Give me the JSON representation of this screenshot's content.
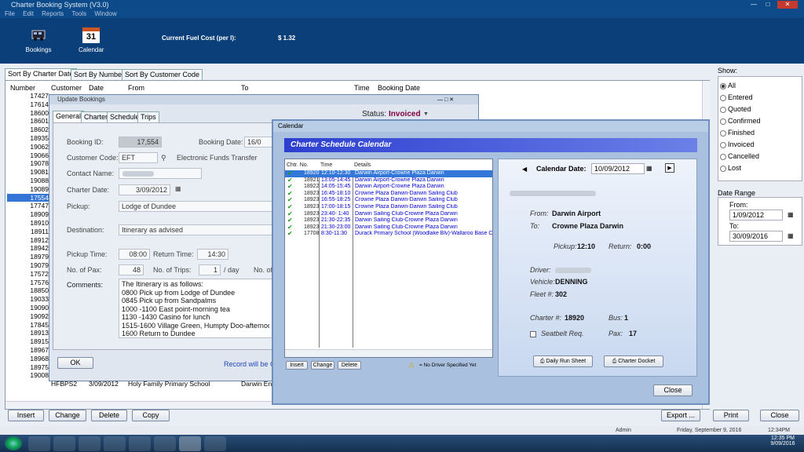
{
  "app": {
    "title": "Charter Booking System (V3.0)"
  },
  "menu": [
    "File",
    "Edit",
    "Reports",
    "Tools",
    "Window"
  ],
  "toolbar": {
    "bookings_label": "Bookings",
    "calendar_label": "Calendar",
    "calendar_day": "31",
    "fuel_label": "Current Fuel Cost (per l):",
    "fuel_value": "$ 1.32"
  },
  "tabs": [
    "Sort By Charter Date",
    "Sort By Number",
    "Sort By Customer Code"
  ],
  "grid": {
    "headers": [
      "Number",
      "Customer",
      "Date",
      "From",
      "To",
      "Time",
      "Booking Date"
    ],
    "numbers": [
      "17427",
      "17614",
      "18600",
      "18601",
      "18602",
      "18935",
      "19062",
      "19066",
      "19078",
      "19081",
      "19088",
      "19089",
      "17554",
      "17747",
      "18909",
      "18910",
      "18911",
      "18912",
      "18942",
      "18979",
      "19079",
      "17572",
      "17576",
      "18850",
      "19033",
      "19090",
      "19092",
      "17845",
      "18913",
      "18915",
      "18967",
      "18968",
      "18975",
      "19008"
    ],
    "selected_index": 12,
    "last_row": {
      "customer": "HFBPS2",
      "date": "3/09/2012",
      "from": "Holy Family Primary School",
      "to": "Darwin Ent"
    }
  },
  "bottom_buttons": {
    "insert": "Insert",
    "change": "Change",
    "delete": "Delete",
    "copy": "Copy",
    "export": "Export ...",
    "print": "Print",
    "close": "Close"
  },
  "show": {
    "title": "Show:",
    "options": [
      "All",
      "Entered",
      "Quoted",
      "Confirmed",
      "Finished",
      "Invoiced",
      "Cancelled",
      "Lost"
    ],
    "selected": "All"
  },
  "date_range": {
    "title": "Date Range",
    "from_label": "From:",
    "from_value": "1/09/2012",
    "to_label": "To:",
    "to_value": "30/09/2016"
  },
  "update": {
    "title": "Update Bookings",
    "tabs": [
      "General",
      "Charter",
      "Schedule",
      "Trips"
    ],
    "status_label": "Status:",
    "status_value": "Invoiced",
    "booking_id_label": "Booking ID:",
    "booking_id": "17,554",
    "booking_date_label": "Booking Date:",
    "booking_date": "16/0",
    "customer_code_label": "Customer Code:",
    "customer_code": "EFT",
    "customer_name": "Electronic Funds Transfer",
    "contact_label": "Contact Name:",
    "charter_date_label": "Charter Date:",
    "charter_date": "3/09/2012",
    "pickup_label": "Pickup:",
    "pickup": "Lodge of Dundee",
    "destination_label": "Destination:",
    "destination": "Itinerary as advised",
    "pickup_time_label": "Pickup Time:",
    "pickup_time": "08:00",
    "return_time_label": "Return Time:",
    "return_time": "14:30",
    "pax_label": "No. of Pax:",
    "pax": "48",
    "trips_label": "No. of Trips:",
    "trips": "1",
    "per_day": "/ day",
    "no_of": "No. of",
    "comments_label": "Comments:",
    "comments": [
      "The Itinerary is as follows:",
      "0800  Pick up from Lodge of Dundee",
      "0845  Pick up from Sandpalms",
      "1000 -1100  East point-morning tea",
      "1130 -1430  Casino for lunch",
      "1515-1600  Village Green, Humpty Doo-afternoon t",
      "1600  Return to Dundee"
    ],
    "ok": "OK",
    "record_msg": "Record will be C"
  },
  "calendar": {
    "title": "Calendar",
    "header": "Charter Schedule Calendar",
    "columns": [
      "Chtr. No.",
      "Time",
      "Details"
    ],
    "rows": [
      {
        "no": "18920",
        "time": "12:10-12:30",
        "details": "Darwin Airport-Crowne Plaza Darwin",
        "selected": true
      },
      {
        "no": "18921",
        "time": "13:05-14:45",
        "details": "Darwin Airport-Crowne Plaza Darwin"
      },
      {
        "no": "18922",
        "time": "14:05-15:45",
        "details": "Darwin Airport-Crowne Plaza Darwin"
      },
      {
        "no": "18923",
        "time": "16:45-18:10",
        "details": "Crowne Plaza Darwin-Darwin Sailing Club"
      },
      {
        "no": "18923",
        "time": "16:55-18:25",
        "details": "Crowne Plaza Darwin-Darwin Sailing Club"
      },
      {
        "no": "18923",
        "time": "17:00-18:15",
        "details": "Crowne Plaza Darwin-Darwin Sailing Club"
      },
      {
        "no": "18923",
        "time": "23:40- 1:40",
        "details": "Darwin Sailing Club-Crowne Plaza Darwin"
      },
      {
        "no": "18923",
        "time": "21:30-22:35",
        "details": "Darwin Sailing Club-Crowne Plaza Darwin"
      },
      {
        "no": "18923",
        "time": "21:30-23:00",
        "details": "Darwin Sailing Club-Crowne Plaza Darwin"
      },
      {
        "no": "17708",
        "time": "8:30-11:30",
        "details": "Durack Primary School (Woodlake Blv)-Wallaroo Base Car"
      }
    ],
    "list_buttons": {
      "insert": "Insert",
      "change": "Change",
      "delete": "Delete"
    },
    "legend": "= No Driver Specified Yet",
    "date_label": "Calendar Date:",
    "date_value": "10/09/2012",
    "from_label": "From:",
    "from_value": "Darwin Airport",
    "to_label": "To:",
    "to_value": "Crowne Plaza Darwin",
    "pickup_label": "Pickup:",
    "pickup_value": "12:10",
    "return_label": "Return:",
    "return_value": "0:00",
    "driver_label": "Driver:",
    "vehicle_label": "Vehicle:",
    "vehicle_value": "DENNING",
    "fleet_label": "Fleet #:",
    "fleet_value": "302",
    "charter_label": "Charter #:",
    "charter_value": "18920",
    "bus_label": "Bus:",
    "bus_value": "1",
    "seatbelt_label": "Seatbelt Req.",
    "pax_label": "Pax:",
    "pax_value": "17",
    "run_sheet": "Daily Run Sheet",
    "docket": "Charter Docket",
    "close": "Close"
  },
  "status": {
    "user": "Admin",
    "date_long": "Friday, September 9, 2016",
    "time_short": "12:34PM"
  },
  "taskbar": {
    "time": "12:35 PM",
    "date": "9/09/2016"
  }
}
